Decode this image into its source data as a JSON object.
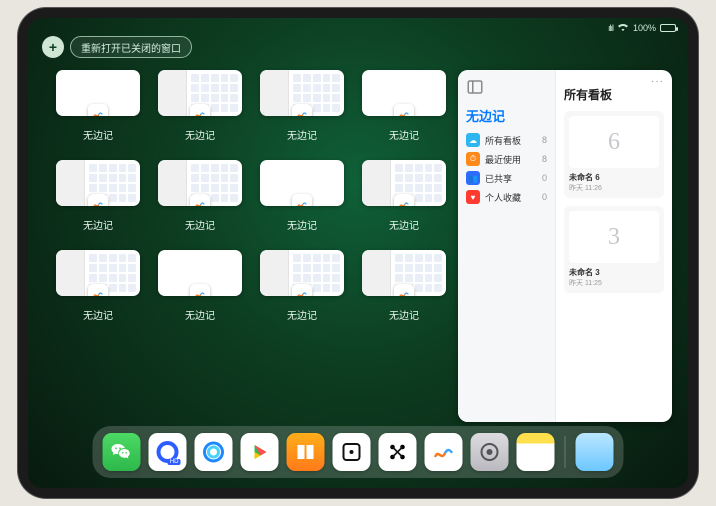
{
  "status": {
    "battery_pct": "100%",
    "wifi": "wifi-icon",
    "signal": "•••"
  },
  "top_controls": {
    "add_label": "+",
    "reopen_closed_label": "重新打开已关闭的窗口"
  },
  "app_name": "无边记",
  "window_thumbs": [
    {
      "label": "无边记",
      "variant": "blank"
    },
    {
      "label": "无边记",
      "variant": "split"
    },
    {
      "label": "无边记",
      "variant": "split"
    },
    {
      "label": "无边记",
      "variant": "blank"
    },
    {
      "label": "无边记",
      "variant": "split"
    },
    {
      "label": "无边记",
      "variant": "split"
    },
    {
      "label": "无边记",
      "variant": "blank"
    },
    {
      "label": "无边记",
      "variant": "split"
    },
    {
      "label": "无边记",
      "variant": "split"
    },
    {
      "label": "无边记",
      "variant": "blank"
    },
    {
      "label": "无边记",
      "variant": "split"
    },
    {
      "label": "无边记",
      "variant": "split"
    }
  ],
  "expose": {
    "sidebar_title": "无边记",
    "categories": [
      {
        "icon": "cloud",
        "label": "所有看板",
        "count": "8"
      },
      {
        "icon": "clock",
        "label": "最近使用",
        "count": "8"
      },
      {
        "icon": "share",
        "label": "已共享",
        "count": "0"
      },
      {
        "icon": "heart",
        "label": "个人收藏",
        "count": "0"
      }
    ],
    "main_title": "所有看板",
    "boards": [
      {
        "glyph": "6",
        "name": "未命名 6",
        "date": "昨天 11:26"
      },
      {
        "glyph": "3",
        "name": "未命名 3",
        "date": "昨天 11:25"
      }
    ],
    "more_label": "···"
  },
  "dock": {
    "apps": [
      {
        "name": "WeChat"
      },
      {
        "name": "优酷HD"
      },
      {
        "name": "QQ浏览器"
      },
      {
        "name": "爱奇艺"
      },
      {
        "name": "Books"
      },
      {
        "name": "随机"
      },
      {
        "name": "连接"
      },
      {
        "name": "无边记"
      },
      {
        "name": "设置"
      },
      {
        "name": "备忘录"
      }
    ],
    "recent_folder": "最近使用"
  }
}
